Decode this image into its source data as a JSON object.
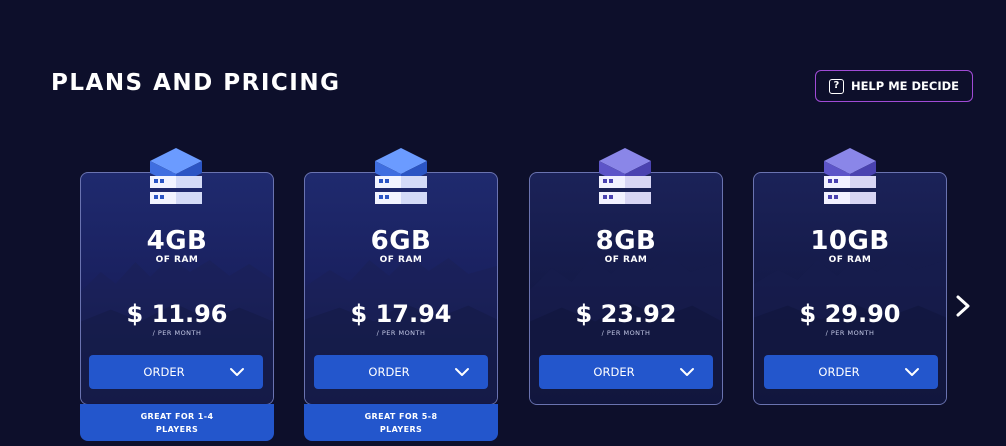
{
  "header": {
    "title": "PLANS AND PRICING",
    "help_label": "HELP ME DECIDE",
    "help_icon_glyph": "?"
  },
  "plans": [
    {
      "ram": "4GB",
      "ram_sub": "OF RAM",
      "price": "$ 11.96",
      "per": "/ PER MONTH",
      "order_label": "ORDER",
      "badge_line1": "GREAT FOR 1-4",
      "badge_line2": "PLAYERS",
      "icon_style": "blue"
    },
    {
      "ram": "6GB",
      "ram_sub": "OF RAM",
      "price": "$ 17.94",
      "per": "/ PER MONTH",
      "order_label": "ORDER",
      "badge_line1": "GREAT FOR 5-8",
      "badge_line2": "PLAYERS",
      "icon_style": "blue"
    },
    {
      "ram": "8GB",
      "ram_sub": "OF RAM",
      "price": "$ 23.92",
      "per": "/ PER MONTH",
      "order_label": "ORDER",
      "icon_style": "purple"
    },
    {
      "ram": "10GB",
      "ram_sub": "OF RAM",
      "price": "$ 29.90",
      "per": "/ PER MONTH",
      "order_label": "ORDER",
      "icon_style": "purple"
    }
  ],
  "icons": {
    "help": "question-square-icon",
    "server": "server-stack-icon",
    "order_chevron": "chevron-down-icon",
    "next": "chevron-right-icon"
  },
  "colors": {
    "background": "#0d0f2b",
    "button": "#2356cc",
    "help_border": "#a04bd6",
    "card_border": "#6a73b0"
  }
}
